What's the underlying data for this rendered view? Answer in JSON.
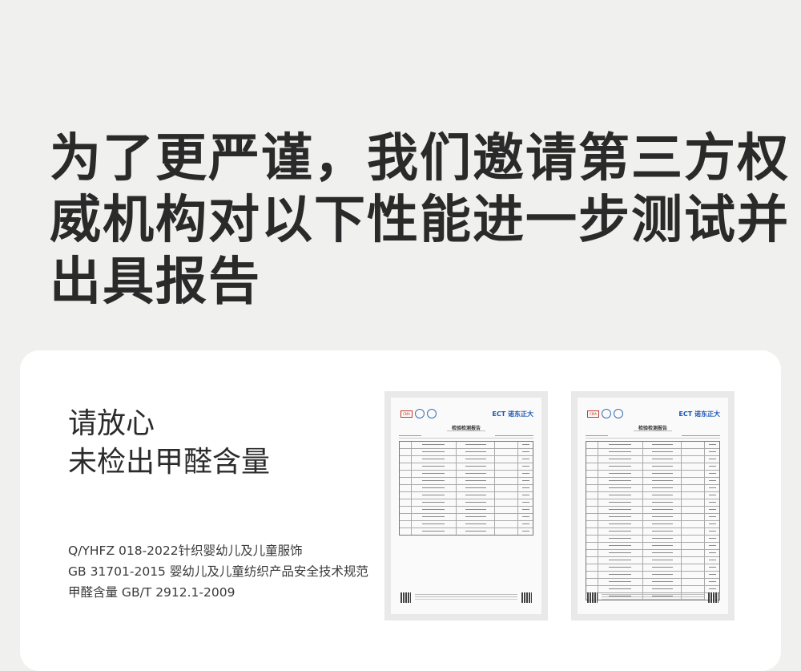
{
  "headline": {
    "lines": [
      "为了更严谨，我们邀请第三方权",
      "威机构对以下性能进一步测试并",
      "出具报告"
    ]
  },
  "card": {
    "reassure_lines": [
      "请放心",
      "未检出甲醛含量"
    ],
    "standards": [
      "Q/YHFZ 018-2022针织婴幼儿及儿童服饰",
      "GB 31701-2015 婴幼儿及儿童纺织产品安全技术规范",
      "甲醛含量 GB/T 2912.1-2009"
    ]
  },
  "reports": [
    {
      "title": "检验检测报告",
      "brand": "ECT 诺东正大",
      "cma": "CMA"
    },
    {
      "title": "检验检测报告",
      "brand": "ECT 诺东正大",
      "cma": "CMA"
    }
  ]
}
